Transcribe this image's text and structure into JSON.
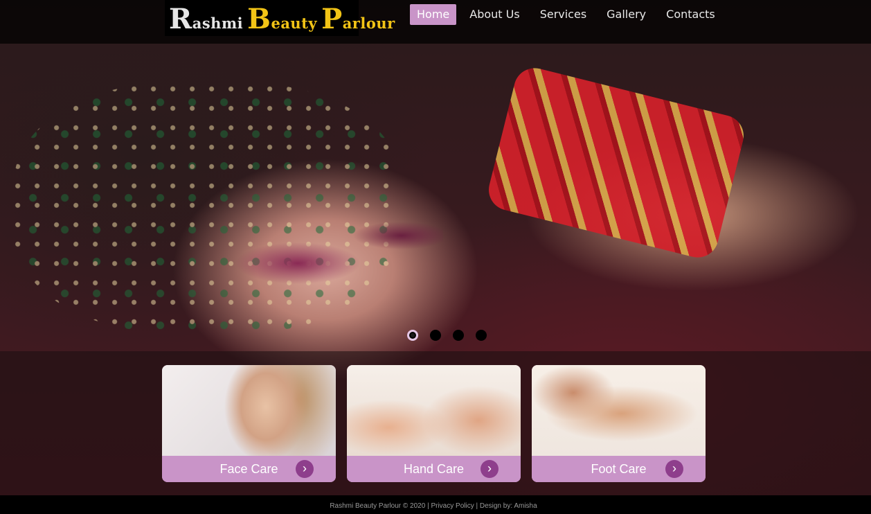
{
  "logo": {
    "w1_big": "R",
    "w1_rest": "ashmi",
    "w2_big": "B",
    "w2_rest": "eauty",
    "w3_big": "P",
    "w3_rest": "arlour"
  },
  "nav": {
    "items": [
      {
        "label": "Home",
        "active": true
      },
      {
        "label": "About Us"
      },
      {
        "label": "Services"
      },
      {
        "label": "Gallery"
      },
      {
        "label": "Contacts"
      }
    ]
  },
  "slider": {
    "dots": 4,
    "active_index": 0
  },
  "cards": [
    {
      "label": "Face Care",
      "image": "face-care-image"
    },
    {
      "label": "Hand Care",
      "image": "hand-care-image"
    },
    {
      "label": "Foot Care",
      "image": "foot-care-image"
    }
  ],
  "footer": {
    "text": "Rashmi Beauty Parlour © 2020 | Privacy Policy | Design by: Amisha"
  },
  "colors": {
    "accent": "#c994c8",
    "arrow": "#8e3e8c",
    "logo_yellow": "#f2c416"
  },
  "icons": {
    "card_arrow": "chevron-right-icon"
  }
}
